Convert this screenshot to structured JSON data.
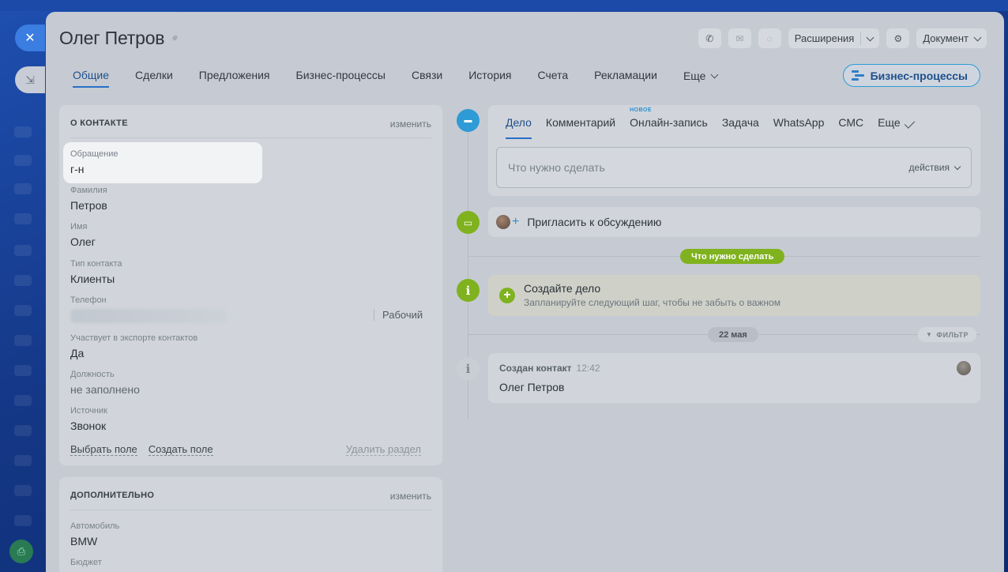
{
  "window": {
    "title": "Олег Петров"
  },
  "toolbar": {
    "extensions_label": "Расширения",
    "document_label": "Документ"
  },
  "tabs": [
    {
      "label": "Общие"
    },
    {
      "label": "Сделки"
    },
    {
      "label": "Предложения"
    },
    {
      "label": "Бизнес-процессы"
    },
    {
      "label": "Связи"
    },
    {
      "label": "История"
    },
    {
      "label": "Счета"
    },
    {
      "label": "Рекламации"
    },
    {
      "label": "Еще"
    }
  ],
  "bp_button_label": "Бизнес-процессы",
  "about": {
    "header": "О КОНТАКТЕ",
    "edit_label": "изменить",
    "fields": [
      {
        "label": "Обращение",
        "value": "г-н"
      },
      {
        "label": "Фамилия",
        "value": "Петров"
      },
      {
        "label": "Имя",
        "value": "Олег"
      },
      {
        "label": "Тип контакта",
        "value": "Клиенты"
      },
      {
        "label": "Телефон",
        "value": ""
      },
      {
        "label": "Участвует в экспорте контактов",
        "value": "Да"
      },
      {
        "label": "Должность",
        "value": "не заполнено"
      },
      {
        "label": "Источник",
        "value": "Звонок"
      }
    ],
    "phone_type": "Рабочий",
    "select_field": "Выбрать поле",
    "create_field": "Создать поле",
    "delete_section": "Удалить раздел"
  },
  "additional": {
    "header": "ДОПОЛНИТЕЛЬНО",
    "edit_label": "изменить",
    "fields": [
      {
        "label": "Автомобиль",
        "value": "BMW"
      },
      {
        "label": "Бюджет",
        "value": ""
      }
    ]
  },
  "activity": {
    "tabs": [
      {
        "label": "Дело"
      },
      {
        "label": "Комментарий"
      },
      {
        "label": "Онлайн-запись",
        "badge": "НОВОЕ"
      },
      {
        "label": "Задача"
      },
      {
        "label": "WhatsApp"
      },
      {
        "label": "СМС"
      },
      {
        "label": "Еще"
      }
    ],
    "placeholder": "Что нужно сделать",
    "actions_label": "действия"
  },
  "timeline": {
    "invite_label": "Пригласить к обсуждению",
    "todo_pill": "Что нужно сделать",
    "create_title": "Создайте дело",
    "create_subtitle": "Запланируйте следующий шаг, чтобы не забыть о важном",
    "date_pill": "22 мая",
    "filter_label": "ФИЛЬТР",
    "event_title": "Создан контакт",
    "event_time": "12:42",
    "event_body": "Олег Петров"
  },
  "colors": {
    "accent": "#2b6fc6",
    "green": "#7fb21e",
    "overlay_panel": "#c6cbd3"
  }
}
